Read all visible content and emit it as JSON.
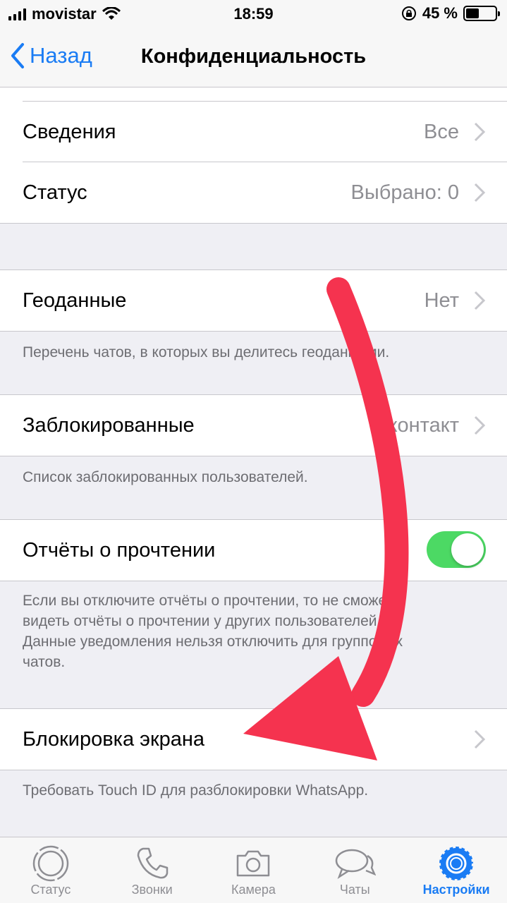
{
  "status": {
    "carrier": "movistar",
    "time": "18:59",
    "battery": "45 %",
    "battery_level": 0.45
  },
  "nav": {
    "back": "Назад",
    "title": "Конфиденциальность"
  },
  "rows": {
    "info": {
      "label": "Сведения",
      "value": "Все"
    },
    "status": {
      "label": "Статус",
      "value": "Выбрано: 0"
    },
    "location": {
      "label": "Геоданные",
      "value": "Нет"
    },
    "location_note": "Перечень чатов, в которых вы делитесь геоданными.",
    "blocked": {
      "label": "Заблокированные",
      "value": "1 контакт"
    },
    "blocked_note": "Список заблокированных пользователей.",
    "read_receipts": {
      "label": "Отчёты о прочтении",
      "enabled": true
    },
    "read_receipts_note": "Если вы отключите отчёты о прочтении, то не сможете видеть отчёты о прочтении у других пользователей. Данные уведомления нельзя отключить для групповых чатов.",
    "screen_lock": {
      "label": "Блокировка экрана"
    },
    "screen_lock_note": "Требовать Touch ID для разблокировки WhatsApp."
  },
  "tabs": [
    {
      "label": "Статус",
      "icon": "status-icon"
    },
    {
      "label": "Звонки",
      "icon": "phone-icon"
    },
    {
      "label": "Камера",
      "icon": "camera-icon"
    },
    {
      "label": "Чаты",
      "icon": "chat-bubbles-icon"
    },
    {
      "label": "Настройки",
      "icon": "gear-icon",
      "active": true
    }
  ],
  "colors": {
    "accent": "#1a7cf4",
    "toggle_on": "#4cd964",
    "annotation_arrow": "#f5334f"
  }
}
